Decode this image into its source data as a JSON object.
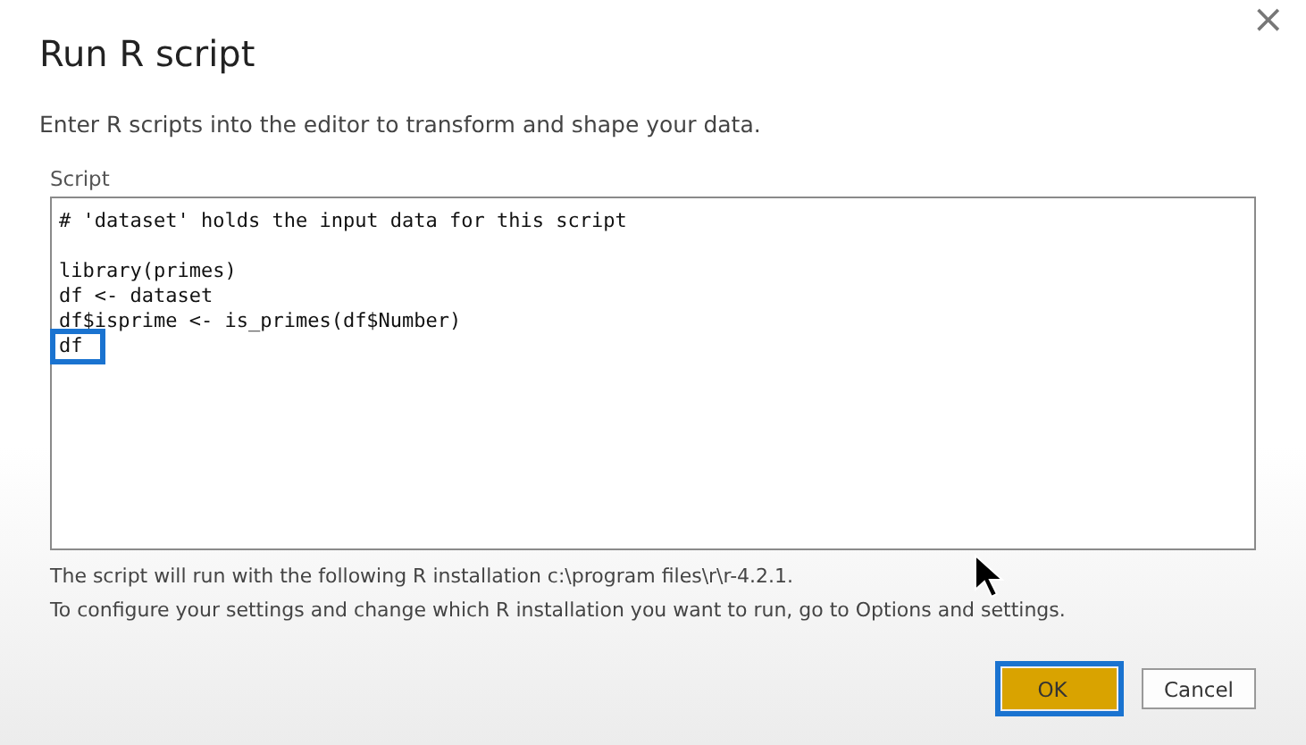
{
  "dialog": {
    "title": "Run R script",
    "close": "×",
    "description": "Enter R scripts into the editor to transform and shape your data."
  },
  "editor": {
    "label": "Script",
    "blocks": [
      [
        {
          "text": "# 'dataset' holds the input data for this script",
          "highlighted": false
        }
      ],
      [
        {
          "text": "library(primes)",
          "highlighted": false
        },
        {
          "text": "df <- dataset",
          "highlighted": false
        },
        {
          "text": "df$isprime <- is_primes(df$Number)",
          "highlighted": false
        },
        {
          "text": "df",
          "highlighted": true
        }
      ]
    ]
  },
  "notes": [
    "The script will run with the following R installation c:\\program files\\r\\r-4.2.1.",
    "To configure your settings and change which R installation you want to run, go to Options and settings."
  ],
  "buttons": [
    {
      "label": "OK",
      "kind": "primary",
      "highlighted": true
    },
    {
      "label": "Cancel",
      "kind": "secondary",
      "highlighted": false
    }
  ]
}
